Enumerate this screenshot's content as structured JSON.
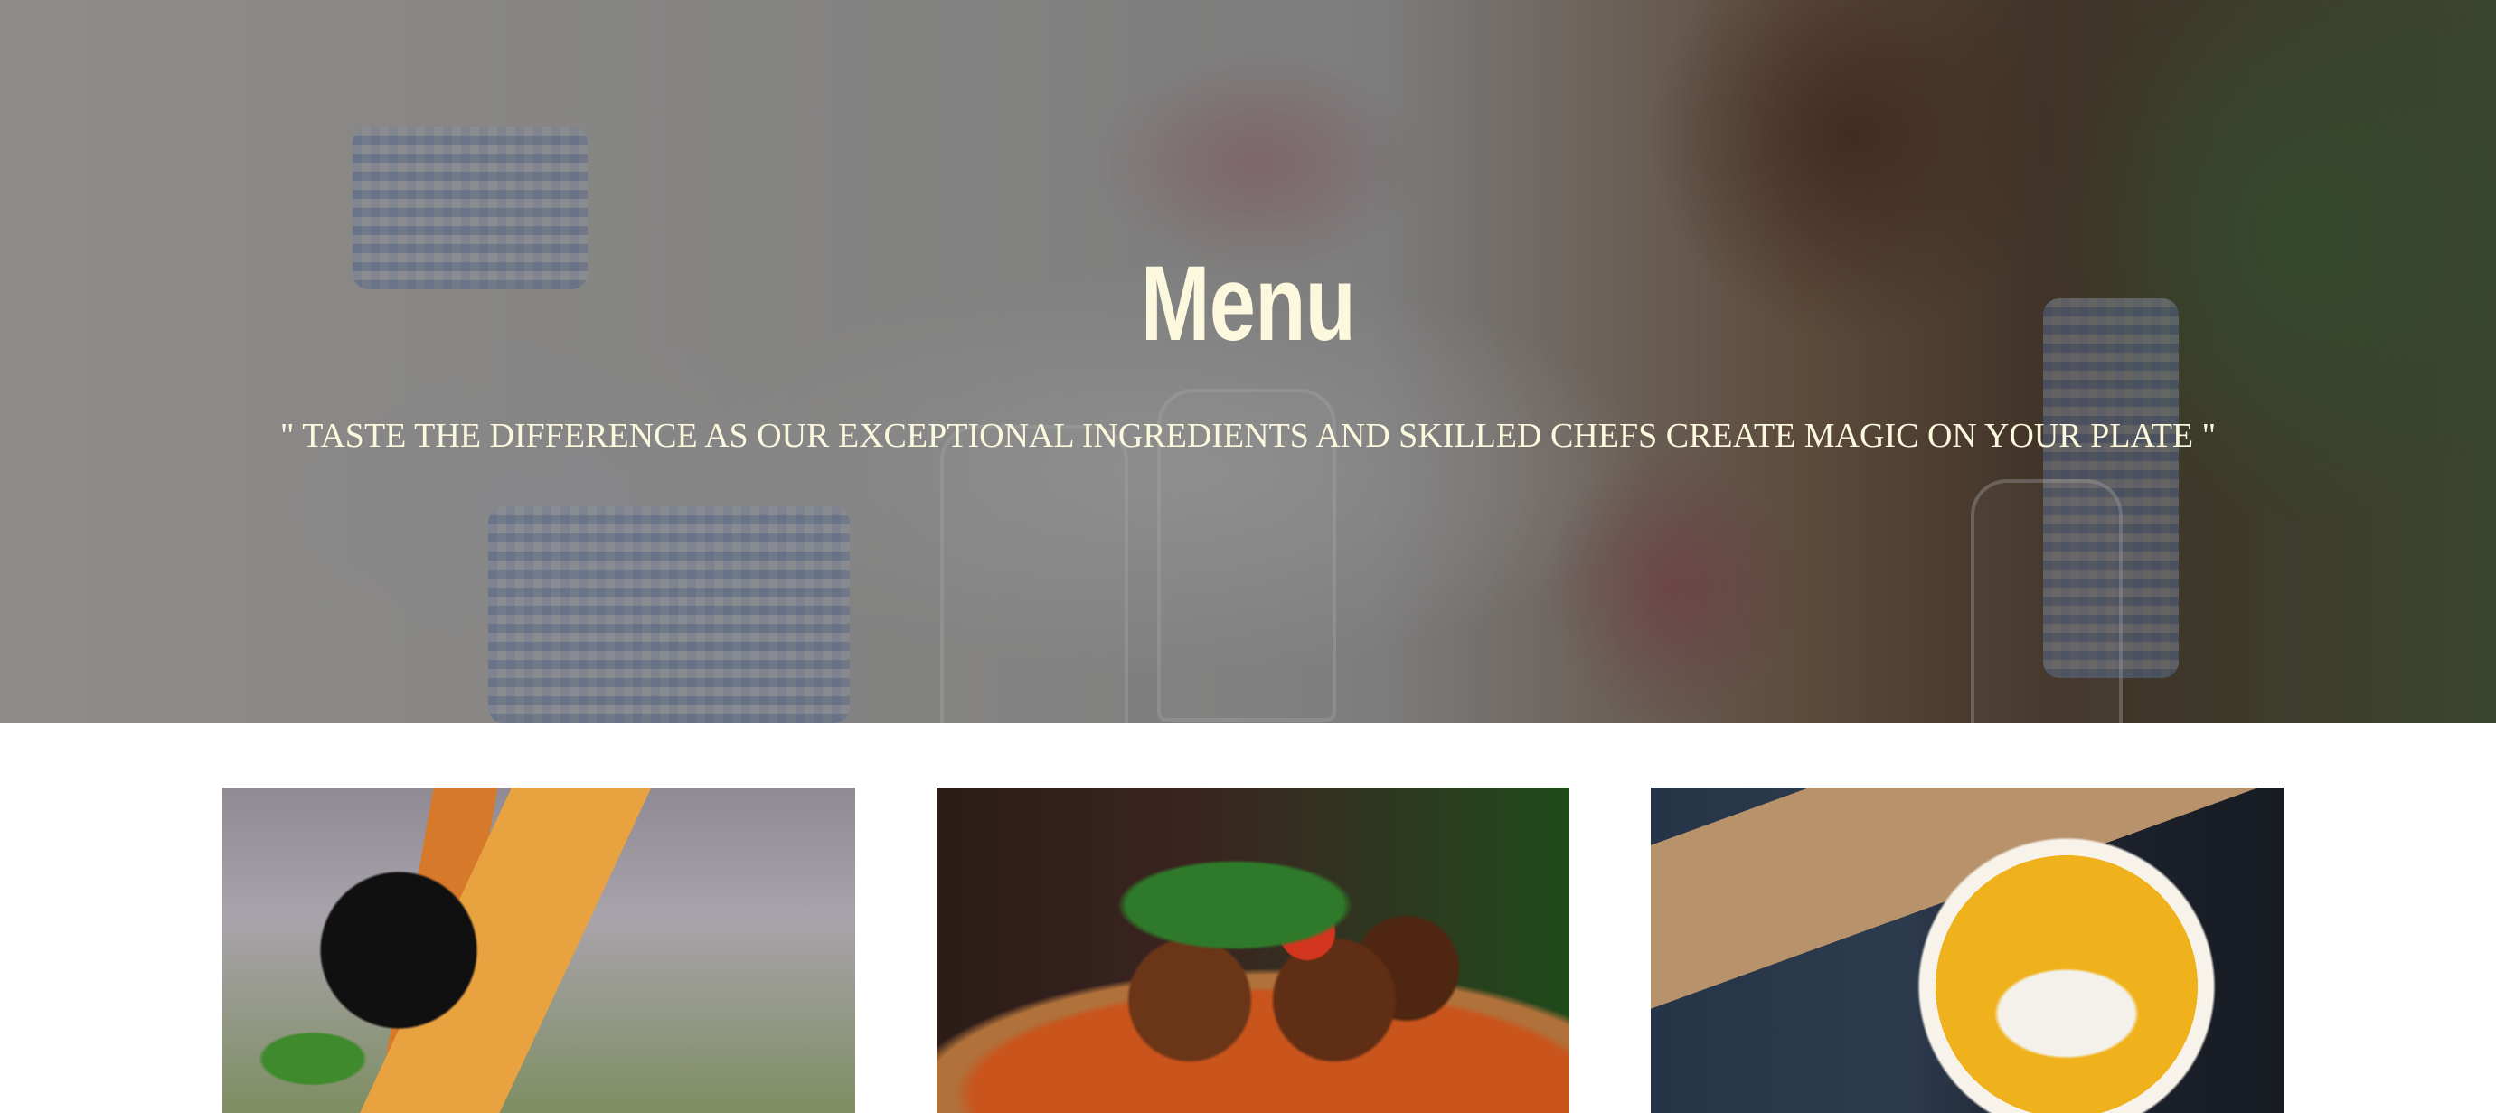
{
  "hero": {
    "title": "Menu",
    "tagline": "\" TASTE THE DIFFERENCE AS OUR EXCEPTIONAL INGREDIENTS AND SKILLED CHEFS CREATE MAGIC ON YOUR PLATE \"",
    "overlay_color": "#141414",
    "text_color": "#fbf8de"
  },
  "gallery": {
    "items": [
      {
        "icon": "pasta-dish-image"
      },
      {
        "icon": "meatballs-dish-image"
      },
      {
        "icon": "pumpkin-soup-image"
      }
    ]
  }
}
